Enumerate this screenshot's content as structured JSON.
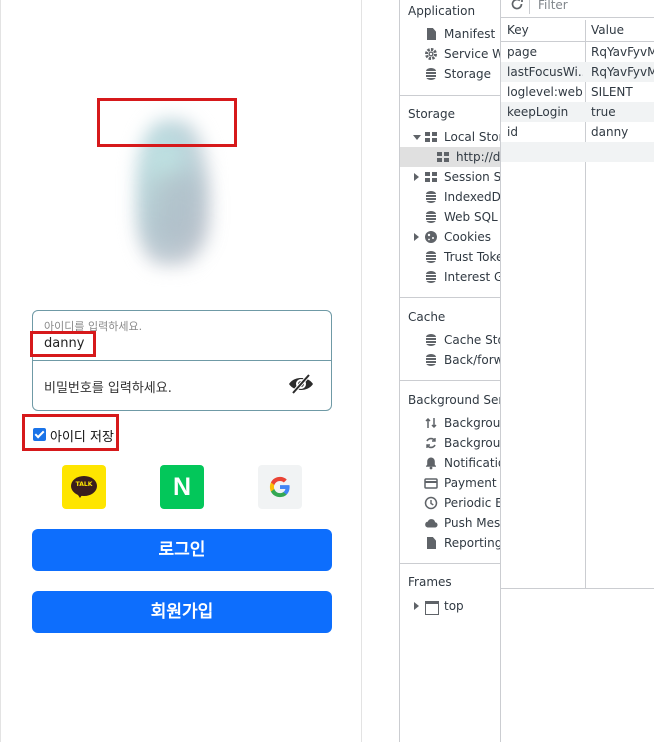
{
  "login": {
    "id_label": "아이디를 입력하세요.",
    "id_value": "danny",
    "password_placeholder": "비밀번호를 입력하세요.",
    "remember_label": "아이디 저장",
    "remember_checked": true,
    "kakao_text": "TALK",
    "naver_text": "N",
    "login_button": "로그인",
    "signup_button": "회원가입",
    "colors": {
      "primary": "#0d6efd",
      "kakao": "#fee500",
      "naver": "#03c75a",
      "highlight": "#d6191b"
    }
  },
  "devtools": {
    "sections": {
      "application": "Application",
      "storage": "Storage",
      "cache": "Cache",
      "background": "Background Servi",
      "frames": "Frames"
    },
    "application_items": [
      {
        "label": "Manifest",
        "icon": "file-icon"
      },
      {
        "label": "Service Wo",
        "icon": "gear-icon"
      },
      {
        "label": "Storage",
        "icon": "database-icon"
      }
    ],
    "storage_items": [
      {
        "label": "Local Stora",
        "icon": "grid-icon"
      },
      {
        "label": "http://de",
        "icon": "grid-icon"
      },
      {
        "label": "Session Sto",
        "icon": "grid-icon"
      },
      {
        "label": "IndexedDB",
        "icon": "database-icon"
      },
      {
        "label": "Web SQL",
        "icon": "database-icon"
      },
      {
        "label": "Cookies",
        "icon": "cookie-icon"
      },
      {
        "label": "Trust Toker",
        "icon": "database-icon"
      },
      {
        "label": "Interest Gro",
        "icon": "database-icon"
      }
    ],
    "cache_items": [
      {
        "label": "Cache Stor",
        "icon": "database-icon"
      },
      {
        "label": "Back/forwa",
        "icon": "database-icon"
      }
    ],
    "background_items": [
      {
        "label": "Backgroun",
        "icon": "arrows-icon"
      },
      {
        "label": "Backgroun",
        "icon": "sync-icon"
      },
      {
        "label": "Notificatio",
        "icon": "bell-icon"
      },
      {
        "label": "Payment H",
        "icon": "card-icon"
      },
      {
        "label": "Periodic Ba",
        "icon": "clock-icon"
      },
      {
        "label": "Push Mess",
        "icon": "cloud-icon"
      },
      {
        "label": "Reporting /",
        "icon": "file-icon"
      }
    ],
    "frames_items": [
      {
        "label": "top",
        "icon": "frame-icon"
      }
    ],
    "filter_placeholder": "Filter",
    "table": {
      "headers": [
        "Key",
        "Value"
      ],
      "rows": [
        {
          "key": "page",
          "value": "RqYavFyvMt"
        },
        {
          "key": "lastFocusWi...",
          "value": "RqYavFyvMt"
        },
        {
          "key": "loglevel:web...",
          "value": "SILENT"
        },
        {
          "key": "keepLogin",
          "value": "true"
        },
        {
          "key": "id",
          "value": "danny"
        }
      ]
    }
  }
}
